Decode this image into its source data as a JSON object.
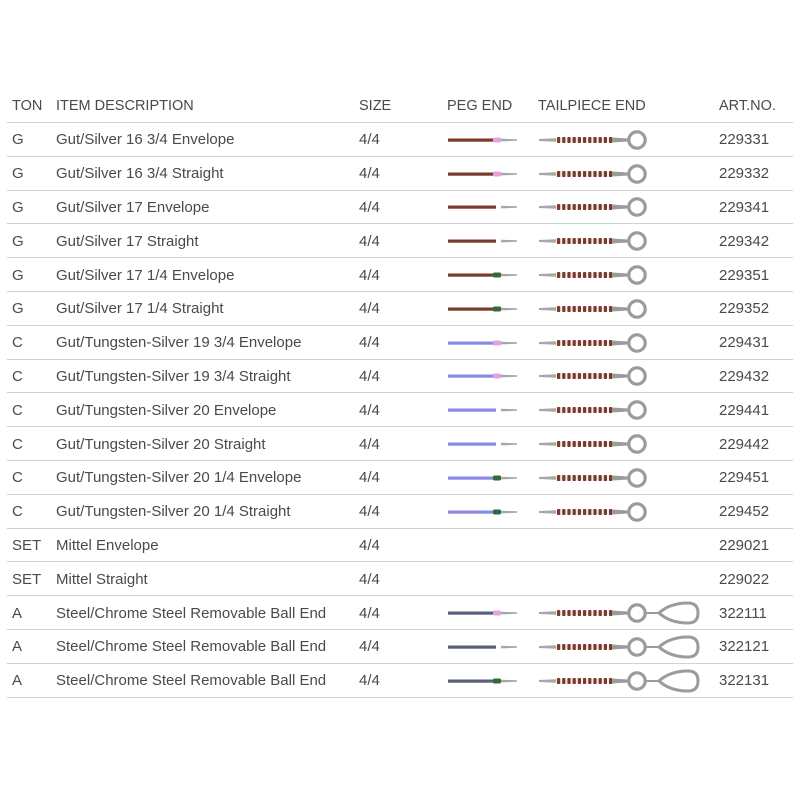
{
  "table": {
    "headers": {
      "ton": "TON",
      "description": "ITEM DESCRIPTION",
      "size": "SIZE",
      "peg_end": "PEG END",
      "tailpiece_end": "TAILPIECE END",
      "art_no": "ART.NO."
    },
    "rows": [
      {
        "ton": "G",
        "description": "Gut/Silver 16 3/4 Envelope",
        "size": "4/4",
        "art_no": "229331",
        "peg": {
          "string_color": "#7a3a2c",
          "silk_color": "#e8a0dc"
        },
        "tail": "loop"
      },
      {
        "ton": "G",
        "description": "Gut/Silver 16 3/4 Straight",
        "size": "4/4",
        "art_no": "229332",
        "peg": {
          "string_color": "#7a3a2c",
          "silk_color": "#e8a0dc"
        },
        "tail": "loop"
      },
      {
        "ton": "G",
        "description": "Gut/Silver 17 Envelope",
        "size": "4/4",
        "art_no": "229341",
        "peg": {
          "string_color": "#7a3a2c",
          "silk_color": ""
        },
        "tail": "loop"
      },
      {
        "ton": "G",
        "description": "Gut/Silver 17 Straight",
        "size": "4/4",
        "art_no": "229342",
        "peg": {
          "string_color": "#7a3a2c",
          "silk_color": ""
        },
        "tail": "loop"
      },
      {
        "ton": "G",
        "description": "Gut/Silver 17 1/4 Envelope",
        "size": "4/4",
        "art_no": "229351",
        "peg": {
          "string_color": "#7a3a2c",
          "silk_color": "#2f6b3a"
        },
        "tail": "loop"
      },
      {
        "ton": "G",
        "description": "Gut/Silver 17 1/4 Straight",
        "size": "4/4",
        "art_no": "229352",
        "peg": {
          "string_color": "#7a3a2c",
          "silk_color": "#2f6b3a"
        },
        "tail": "loop"
      },
      {
        "ton": "C",
        "description": "Gut/Tungsten-Silver 19 3/4 Envelope",
        "size": "4/4",
        "art_no": "229431",
        "peg": {
          "string_color": "#8a8ae6",
          "silk_color": "#e8a0dc"
        },
        "tail": "loop"
      },
      {
        "ton": "C",
        "description": "Gut/Tungsten-Silver 19 3/4 Straight",
        "size": "4/4",
        "art_no": "229432",
        "peg": {
          "string_color": "#8a8ae6",
          "silk_color": "#e8a0dc"
        },
        "tail": "loop"
      },
      {
        "ton": "C",
        "description": "Gut/Tungsten-Silver 20 Envelope",
        "size": "4/4",
        "art_no": "229441",
        "peg": {
          "string_color": "#8a8ae6",
          "silk_color": ""
        },
        "tail": "loop"
      },
      {
        "ton": "C",
        "description": "Gut/Tungsten-Silver 20 Straight",
        "size": "4/4",
        "art_no": "229442",
        "peg": {
          "string_color": "#8a8ae6",
          "silk_color": ""
        },
        "tail": "loop"
      },
      {
        "ton": "C",
        "description": "Gut/Tungsten-Silver 20 1/4 Envelope",
        "size": "4/4",
        "art_no": "229451",
        "peg": {
          "string_color": "#8a8ae6",
          "silk_color": "#2f6b3a"
        },
        "tail": "loop"
      },
      {
        "ton": "C",
        "description": "Gut/Tungsten-Silver 20 1/4 Straight",
        "size": "4/4",
        "art_no": "229452",
        "peg": {
          "string_color": "#8a8ae6",
          "silk_color": "#2f6b3a"
        },
        "tail": "loop"
      },
      {
        "ton": "SET",
        "description": "Mittel Envelope",
        "size": "4/4",
        "art_no": "229021",
        "peg": null,
        "tail": "none"
      },
      {
        "ton": "SET",
        "description": "Mittel Straight",
        "size": "4/4",
        "art_no": "229022",
        "peg": null,
        "tail": "none"
      },
      {
        "ton": "A",
        "description": "Steel/Chrome Steel Removable Ball End",
        "size": "4/4",
        "art_no": "322111",
        "peg": {
          "string_color": "#5a5f78",
          "silk_color": "#e8a0dc"
        },
        "tail": "loop-ball"
      },
      {
        "ton": "A",
        "description": "Steel/Chrome Steel Removable Ball End",
        "size": "4/4",
        "art_no": "322121",
        "peg": {
          "string_color": "#5a5f78",
          "silk_color": ""
        },
        "tail": "loop-ball"
      },
      {
        "ton": "A",
        "description": "Steel/Chrome Steel Removable Ball End",
        "size": "4/4",
        "art_no": "322131",
        "peg": {
          "string_color": "#5a5f78",
          "silk_color": "#2f6b3a"
        },
        "tail": "loop-ball"
      }
    ]
  }
}
